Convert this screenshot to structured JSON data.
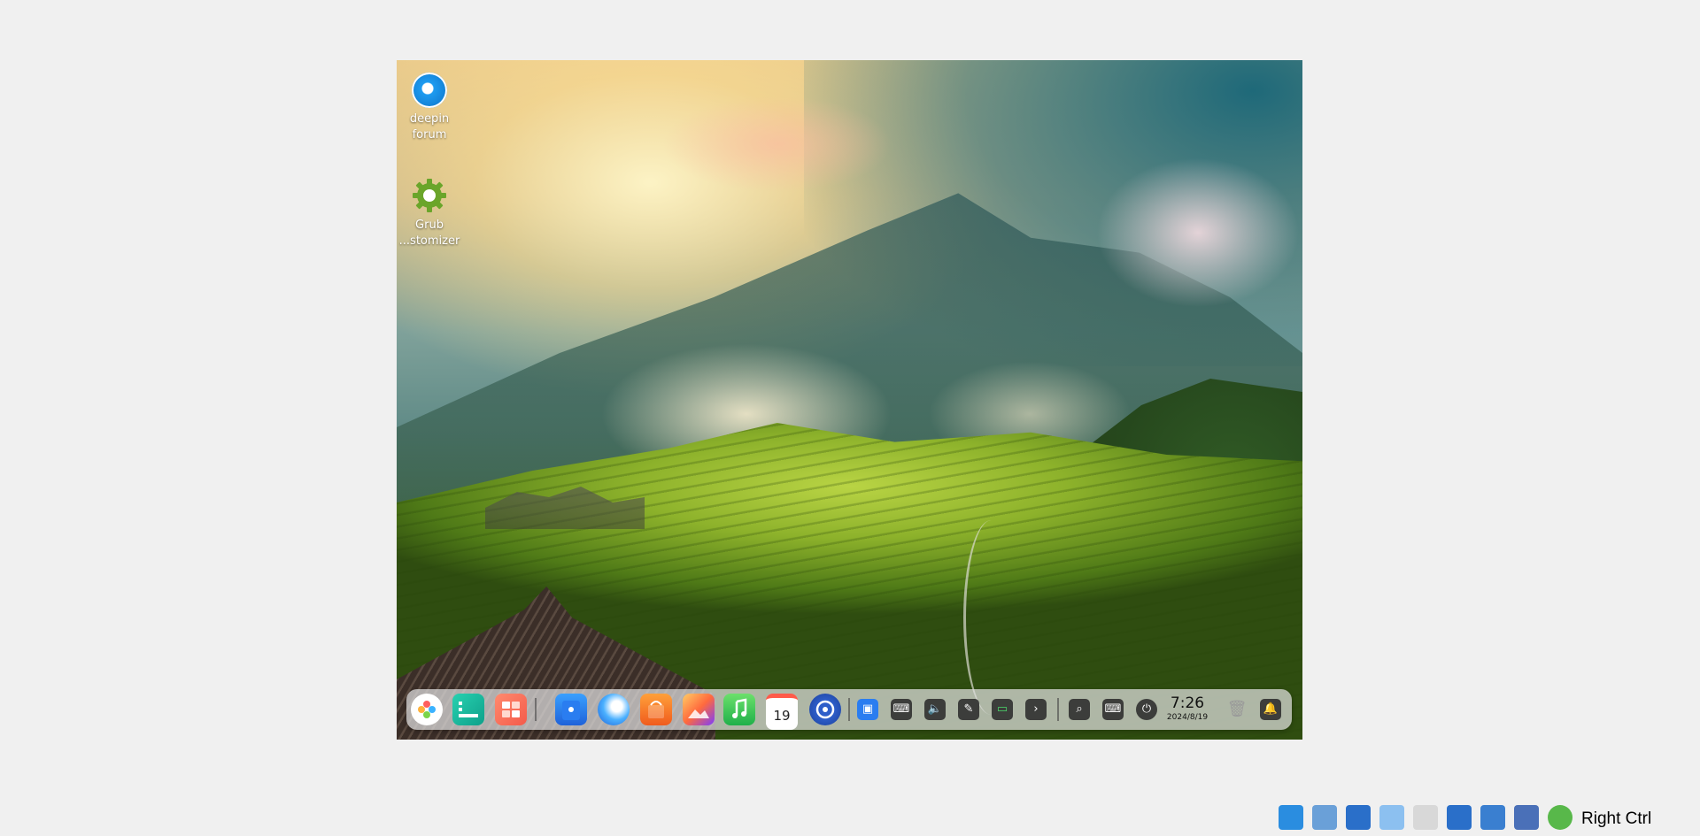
{
  "desktop": {
    "icons": [
      {
        "label_line1": "deepin",
        "label_line2": "forum",
        "icon": "deepin-logo-icon"
      },
      {
        "label_line1": "Grub",
        "label_line2": "...stomizer",
        "icon": "gear-icon"
      }
    ]
  },
  "dock": {
    "apps": [
      {
        "name": "launcher",
        "icon": "launcher-icon"
      },
      {
        "name": "multitasking",
        "icon": "multitask-icon"
      },
      {
        "name": "workspace",
        "icon": "workspace-icon"
      },
      {
        "name": "file-manager",
        "icon": "file-manager-icon"
      },
      {
        "name": "browser",
        "icon": "browser-icon"
      },
      {
        "name": "app-store",
        "icon": "app-store-icon"
      },
      {
        "name": "image-viewer",
        "icon": "photos-icon"
      },
      {
        "name": "music",
        "icon": "music-icon"
      },
      {
        "name": "calendar",
        "icon": "calendar-icon",
        "day": "19"
      },
      {
        "name": "control-center",
        "icon": "settings-icon"
      }
    ],
    "tray": [
      {
        "icon": "screenshot-icon"
      },
      {
        "icon": "keyboard-icon"
      },
      {
        "icon": "volume-icon"
      },
      {
        "icon": "pen-icon"
      },
      {
        "icon": "battery-icon"
      },
      {
        "icon": "chevron-right-icon",
        "glyph": "›"
      }
    ],
    "right": [
      {
        "icon": "search-icon"
      },
      {
        "icon": "keyboard-layout-icon"
      },
      {
        "icon": "power-icon"
      }
    ],
    "clock": {
      "time": "7:26",
      "date": "2024/8/19"
    },
    "trash_icon": "trash-icon",
    "notification_icon": "bell-icon"
  },
  "host_status": {
    "label": "Right Ctrl",
    "icons": [
      "optical-drive-icon",
      "audio-icon",
      "network-icon",
      "usb-icon",
      "shared-folder-icon",
      "display-icon",
      "recording-icon",
      "cpu-icon",
      "mouse-integration-icon",
      "download-icon"
    ]
  }
}
